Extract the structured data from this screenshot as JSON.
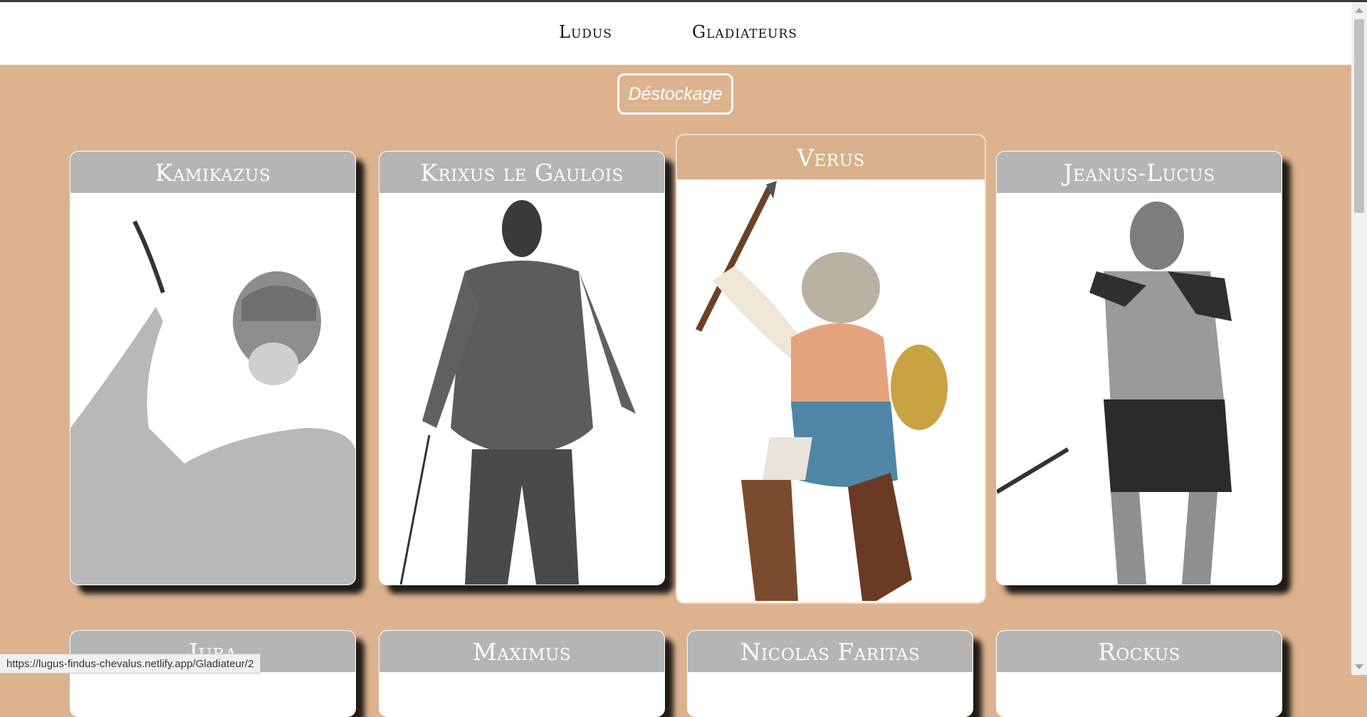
{
  "nav": {
    "items": [
      {
        "label": "Ludus"
      },
      {
        "label": "Gladiateurs"
      }
    ]
  },
  "destock_button": "Déstockage",
  "gladiators": [
    {
      "name": "Kamikazus",
      "image": "gladiator-photo"
    },
    {
      "name": "Krixus le Gaulois",
      "image": "gladiator-photo"
    },
    {
      "name": "Verus",
      "image": "gladiator-illustration",
      "active": true
    },
    {
      "name": "Jeanus-Lucus",
      "image": "gladiator-photo"
    },
    {
      "name": "Juba",
      "image": "gladiator-photo"
    },
    {
      "name": "Maximus",
      "image": "gladiator-photo"
    },
    {
      "name": "Nicolas Faritas",
      "image": "gladiator-photo"
    },
    {
      "name": "Rockus",
      "image": "gladiator-photo"
    }
  ],
  "status_url": "https://lugus-findus-chevalus.netlify.app/Gladiateur/2",
  "colors": {
    "background": "#ddb38f",
    "card_header": "#b5b5b5",
    "active_header": "#d9b08c"
  }
}
